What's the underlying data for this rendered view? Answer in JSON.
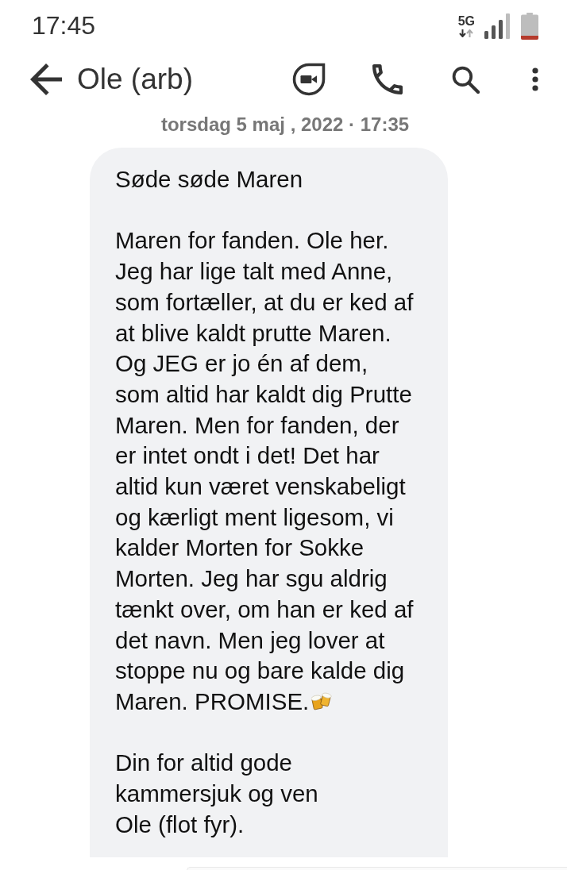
{
  "status_bar": {
    "time": "17:45",
    "network": "5G"
  },
  "toolbar": {
    "title": "Ole (arb)"
  },
  "conversation": {
    "date": "torsdag 5 maj , 2022 · 17:35",
    "messages": [
      {
        "kind": "incoming",
        "paragraphs": [
          {
            "text": "Søde søde Maren"
          },
          {
            "text": "Maren for fanden. Ole her.\nJeg har lige talt med Anne,\nsom fortæller, at du er ked af\nat blive kaldt prutte Maren.\nOg JEG er jo én af dem,\nsom altid har kaldt dig Prutte\nMaren. Men for fanden, der\ner intet ondt i det! Det har\naltid kun været venskabeligt\nog kærligt ment ligesom, vi\nkalder Morten for Sokke\nMorten. Jeg har sgu aldrig\ntænkt over, om han er ked af\ndet navn. Men jeg lover at\nstoppe nu og bare kalde dig\nMaren. PROMISE.",
            "emoji": true
          },
          {
            "text": "Din for altid gode\nkammersjuk og ven\nOle (flot fyr)."
          }
        ]
      },
      {
        "kind": "outgoing"
      }
    ]
  }
}
